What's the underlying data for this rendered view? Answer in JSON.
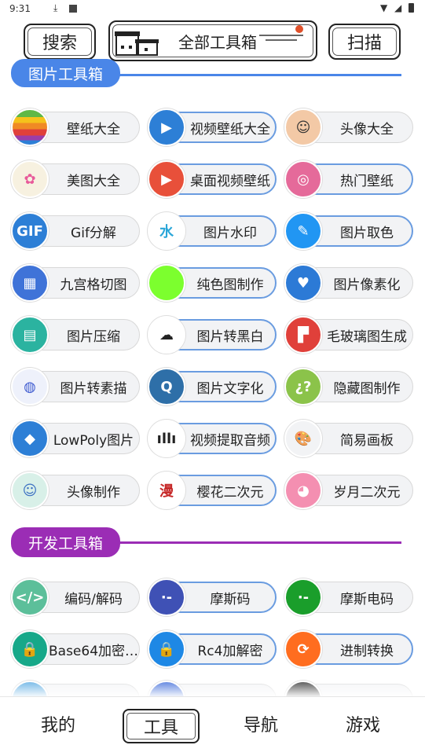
{
  "status": {
    "time": "9:31"
  },
  "header": {
    "search": "搜索",
    "title": "全部工具箱",
    "scan": "扫描"
  },
  "sections": {
    "image": "图片工具箱",
    "dev": "开发工具箱"
  },
  "image_tools": [
    {
      "label": "壁纸大全",
      "icon": "rainbow-apple-icon",
      "color": "#3a8d2f"
    },
    {
      "label": "视频壁纸大全",
      "icon": "play-video-icon",
      "color": "#2d7fd6"
    },
    {
      "label": "头像大全",
      "icon": "boy-face-icon",
      "color": "#f3c9a6"
    },
    {
      "label": "美图大全",
      "icon": "photos-flower-icon",
      "color": "#f7f1e0"
    },
    {
      "label": "桌面视频壁纸",
      "icon": "desktop-video-icon",
      "color": "#e8503a"
    },
    {
      "label": "热门壁纸",
      "icon": "dribbble-ball-icon",
      "color": "#e56a9a"
    },
    {
      "label": "Gif分解",
      "icon": "gif-file-icon",
      "color": "#2d7fd6"
    },
    {
      "label": "图片水印",
      "icon": "watermark-icon",
      "color": "#ffffff"
    },
    {
      "label": "图片取色",
      "icon": "color-picker-icon",
      "color": "#2196f3"
    },
    {
      "label": "九宫格切图",
      "icon": "grid-photos-icon",
      "color": "#3f73d8"
    },
    {
      "label": "纯色图制作",
      "icon": "solid-color-icon",
      "color": "#7cff2e"
    },
    {
      "label": "图片像素化",
      "icon": "pixel-heart-icon",
      "color": "#2c7ad6"
    },
    {
      "label": "图片压缩",
      "icon": "compress-stack-icon",
      "color": "#2bb3a0"
    },
    {
      "label": "图片转黑白",
      "icon": "cloud-refresh-icon",
      "color": "#ffffff"
    },
    {
      "label": "毛玻璃图生成",
      "icon": "flipboard-icon",
      "color": "#e0403a"
    },
    {
      "label": "图片转素描",
      "icon": "sketch-apple-icon",
      "color": "#eef1fb"
    },
    {
      "label": "图片文字化",
      "icon": "q-letter-icon",
      "color": "#2e6fa8"
    },
    {
      "label": "隐藏图制作",
      "icon": "question-marks-icon",
      "color": "#8bc34a"
    },
    {
      "label": "LowPoly图片",
      "icon": "blue-gem-icon",
      "color": "#2d7fd6"
    },
    {
      "label": "视频提取音频",
      "icon": "audio-wave-icon",
      "color": "#ffffff"
    },
    {
      "label": "简易画板",
      "icon": "paint-palette-icon",
      "color": "#f2f3f5"
    },
    {
      "label": "头像制作",
      "icon": "avatar-boy-icon",
      "color": "#d8f0e8"
    },
    {
      "label": "樱花二次元",
      "icon": "manga-stamp-icon",
      "color": "#ffffff"
    },
    {
      "label": "岁月二次元",
      "icon": "pink-robot-icon",
      "color": "#f48fb1"
    }
  ],
  "dev_tools": [
    {
      "label": "编码/解码",
      "icon": "code-tag-icon",
      "color": "#5cbf9a"
    },
    {
      "label": "摩斯码",
      "icon": "morse-dots-icon",
      "color": "#3f51b5"
    },
    {
      "label": "摩斯电码",
      "icon": "morse-signal-icon",
      "color": "#1a9e2b"
    },
    {
      "label": "Base64加密…",
      "icon": "lock-green-icon",
      "color": "#17a889"
    },
    {
      "label": "Rc4加解密",
      "icon": "lock-blue-icon",
      "color": "#1e88e5"
    },
    {
      "label": "进制转换",
      "icon": "sync-arrows-icon",
      "color": "#ff6d1f"
    }
  ],
  "partial_row_colors": [
    "#4aa3df",
    "#2e5fd6",
    "#222222"
  ],
  "nav": {
    "mine": "我的",
    "tools": "工具",
    "navigate": "导航",
    "games": "游戏"
  }
}
